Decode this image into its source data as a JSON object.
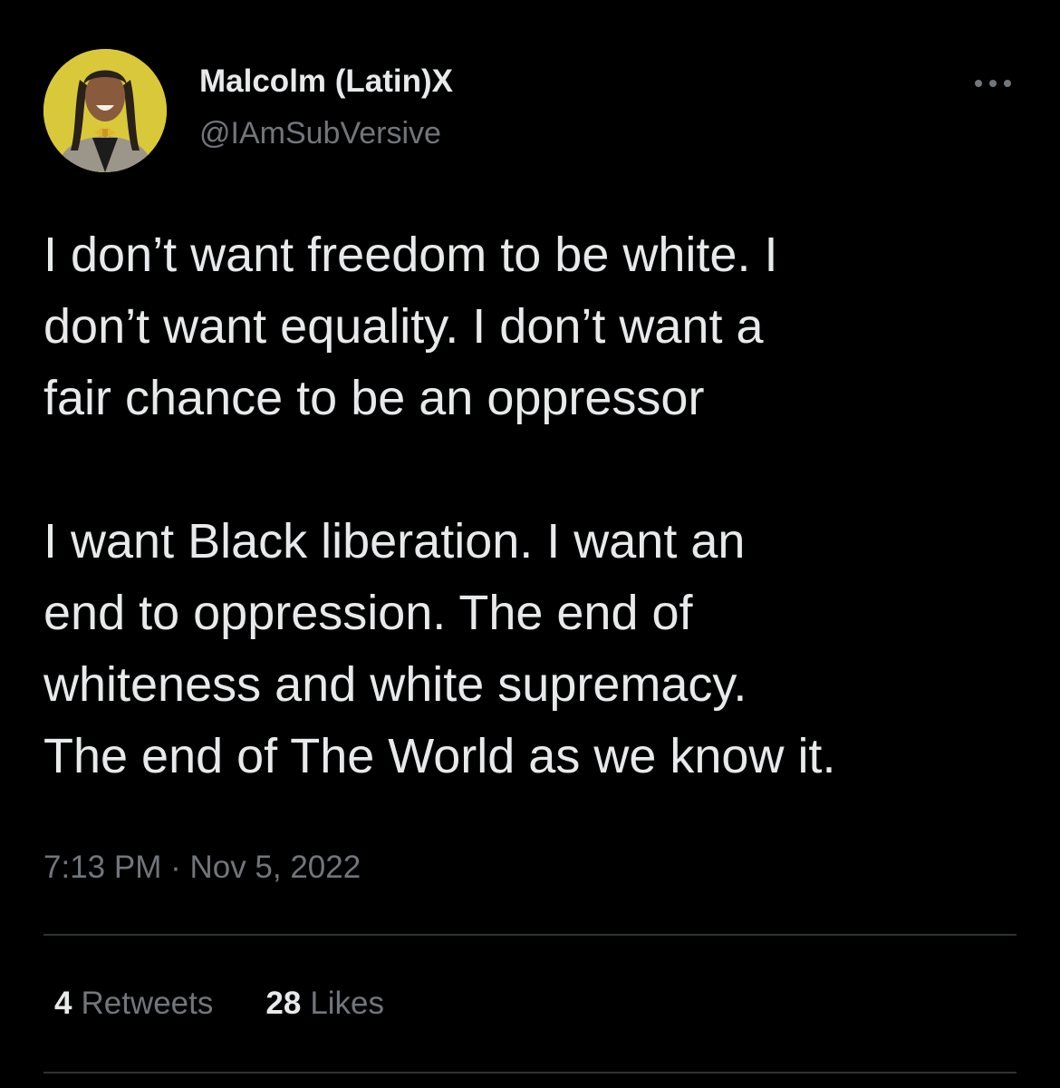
{
  "author": {
    "display_name": "Malcolm (Latin)X",
    "handle": "@IAmSubVersive",
    "avatar_bg": "#d9c93a"
  },
  "more_icon": "more-horizontal-icon",
  "tweet": {
    "text": "I don’t want freedom to be white. I\ndon’t want equality. I don’t want a\nfair chance to be an oppressor\n\nI want Black liberation. I want an\nend to oppression. The end of\nwhiteness and white supremacy.\nThe end of The World as we know it.",
    "timestamp": "7:13 PM · Nov 5, 2022"
  },
  "stats": {
    "retweets_count": "4",
    "retweets_label": "Retweets",
    "likes_count": "28",
    "likes_label": "Likes"
  },
  "colors": {
    "background": "#000000",
    "primary_text": "#e7e9ea",
    "secondary_text": "#71767b",
    "divider": "#2f3336"
  }
}
